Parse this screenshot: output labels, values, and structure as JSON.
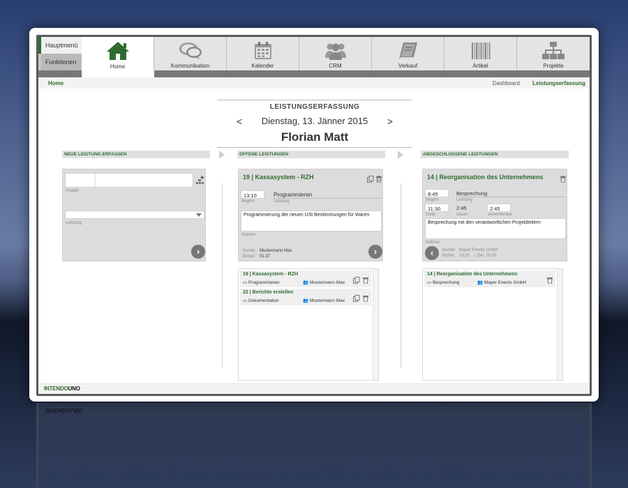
{
  "menu": {
    "main": "Hauptmenü",
    "functions": "Funktionen"
  },
  "tabs": [
    {
      "label": "Home",
      "icon": "home-icon"
    },
    {
      "label": "Kommunikation",
      "icon": "chat-icon"
    },
    {
      "label": "Kalender",
      "icon": "calendar-icon"
    },
    {
      "label": "CRM",
      "icon": "people-icon"
    },
    {
      "label": "Verkauf",
      "icon": "book-icon"
    },
    {
      "label": "Artikel",
      "icon": "barcode-icon"
    },
    {
      "label": "Projekte",
      "icon": "hierarchy-icon"
    }
  ],
  "breadcrumb": {
    "home": "Home",
    "dashboard": "Dashboard",
    "current": "Leistungserfassung"
  },
  "header": {
    "title": "LEISTUNGSERFASSUNG",
    "prev": "<",
    "next": ">",
    "date": "Dienstag, 13. Jänner 2015",
    "name": "Florian Matt"
  },
  "columns": {
    "new": "NEUE LEISTUNG ERFASSEN",
    "open": "OFFENE LEISTUNGEN",
    "closed": "ABGESCHLOSSENE LEISTUNGEN"
  },
  "new_form": {
    "project_label": "Projekt",
    "service_label": "Leistung",
    "next_button": "›"
  },
  "open_card": {
    "title": "19  |  Kassasystem - RZH",
    "begin_value": "13:10",
    "begin_label": "Beginn",
    "service_value": "Programmieren",
    "service_label": "Leistung",
    "notes_value": "Programmierung der neuen USt Bestimmungen für Waren",
    "notes_label": "Notizen",
    "customer_label": "Kunde:",
    "customer_value": "Mustermann Max",
    "so_far_label": "Bisher:",
    "so_far_value": "01:37",
    "next_button": "›"
  },
  "open_list": [
    {
      "title": "19  |  Kassasystem - RZH",
      "service": "Programmieren",
      "person": "Mustermann Max"
    },
    {
      "title": "22  |  Berichte erstellen",
      "service": "Dokumentation",
      "person": "Mustermann Max"
    }
  ],
  "closed_card": {
    "title": "14  |  Reorganisation des Unternehmens",
    "begin_value": "8:45",
    "begin_label": "Beginn",
    "service_value": "Besprechung",
    "service_label": "Leistung",
    "end_value": "11:30",
    "end_label": "Ende",
    "duration_value": "2:45",
    "duration_label": "Dauer",
    "billed_value": "2:45",
    "billed_label": "verrechenbar",
    "notes_value": "Besprechung mit den verantwortlichen Projektleitern",
    "notes_label": "Notizen",
    "customer_label": "Kunde:",
    "customer_value": "Mayer Events GmbH",
    "so_far_label": "Bisher:",
    "so_far_value": "10:25",
    "goal_value": "| Ziel: 70:00",
    "back_button": "‹"
  },
  "closed_list": [
    {
      "title": "14  |  Reorganisation des Unternehmens",
      "service": "Besprechung",
      "person": "Mayer Events GmbH"
    }
  ],
  "footer": {
    "brand_a": "INTENDO",
    "brand_b": "UNO"
  },
  "colors": {
    "accent": "#2f6b2f",
    "panel": "#dcdcdc",
    "strip": "#777777"
  }
}
